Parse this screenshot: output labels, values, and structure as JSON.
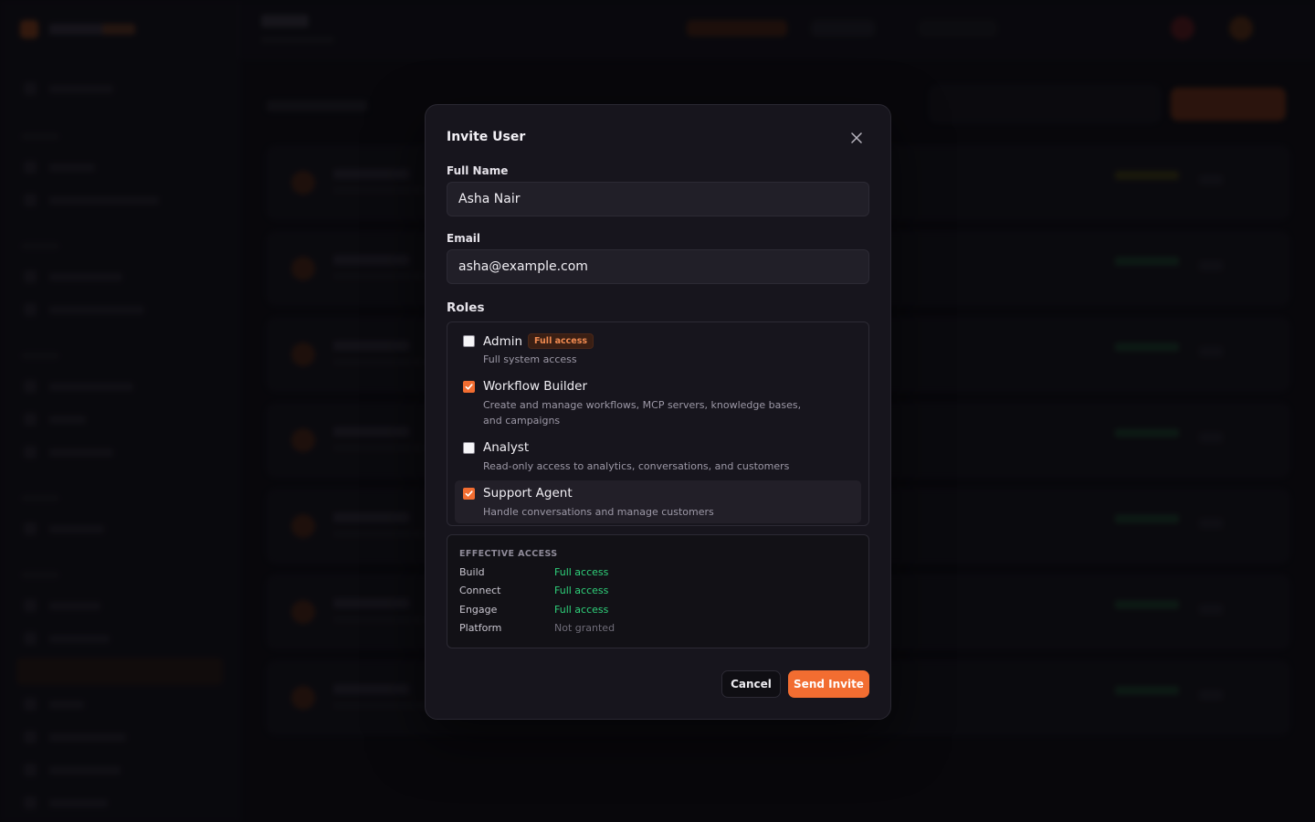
{
  "modal": {
    "title": "Invite User",
    "close_icon": "close-icon",
    "full_name": {
      "label": "Full Name",
      "value": "Asha Nair"
    },
    "email": {
      "label": "Email",
      "value": "asha@example.com"
    },
    "roles": {
      "label": "Roles",
      "items": [
        {
          "name": "Admin",
          "badge": "Full access",
          "description": "Full system access",
          "checked": false
        },
        {
          "name": "Workflow Builder",
          "description": "Create and manage workflows, MCP servers, knowledge bases, and campaigns",
          "checked": true
        },
        {
          "name": "Analyst",
          "description": "Read-only access to analytics, conversations, and customers",
          "checked": false
        },
        {
          "name": "Support Agent",
          "description": "Handle conversations and manage customers",
          "checked": true
        }
      ]
    },
    "effective_access": {
      "heading": "EFFECTIVE ACCESS",
      "rows": [
        {
          "area": "Build",
          "status": "Full access"
        },
        {
          "area": "Connect",
          "status": "Full access"
        },
        {
          "area": "Engage",
          "status": "Full access"
        },
        {
          "area": "Platform",
          "status": "Not granted"
        }
      ]
    },
    "cancel_label": "Cancel",
    "send_label": "Send Invite"
  },
  "colors": {
    "accent": "#f26d31",
    "granted": "#2fd07a",
    "denied": "#6f6c78",
    "modal_bg": "#17151d"
  }
}
